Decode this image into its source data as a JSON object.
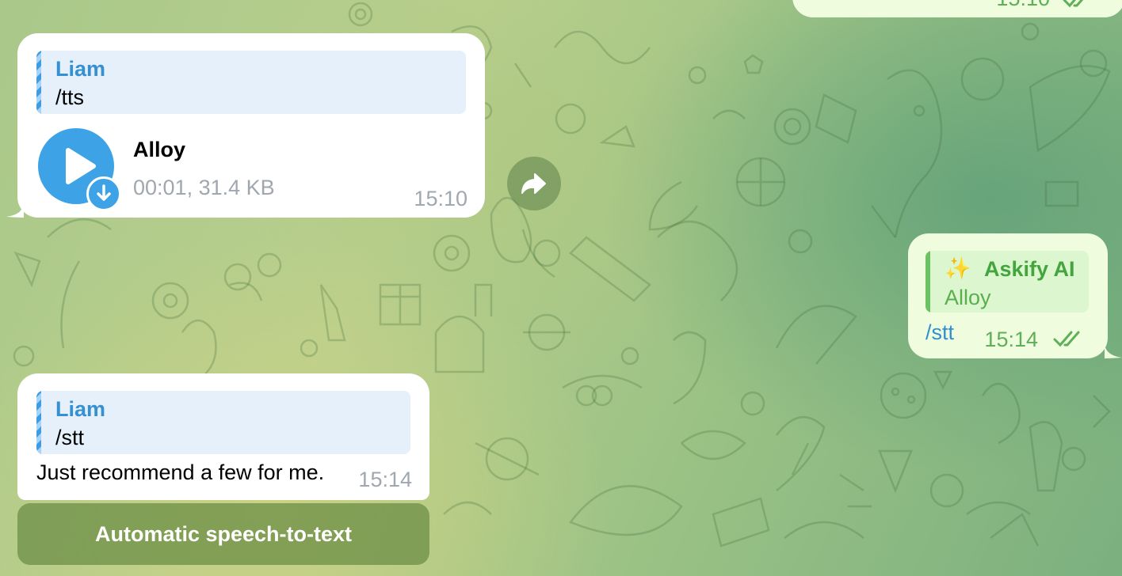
{
  "chat": {
    "messages": [
      {
        "direction": "incoming",
        "reply": {
          "name": "Liam",
          "text": "/tts"
        },
        "audio": {
          "title": "Alloy",
          "meta": "00:01, 31.4 KB"
        },
        "time": "15:10"
      },
      {
        "direction": "outgoing",
        "reply": {
          "emoji": "✨",
          "name": "Askify AI",
          "text": "Alloy"
        },
        "text": "/stt",
        "time": "15:14",
        "status": "read"
      },
      {
        "direction": "incoming",
        "reply": {
          "name": "Liam",
          "text": "/stt"
        },
        "text": "Just recommend a few for me.",
        "time": "15:14"
      }
    ],
    "top_partial_time": "15:10",
    "stt_button_label": "Automatic speech-to-text"
  },
  "icons": {
    "play": "play-icon",
    "download": "download-arrow-icon",
    "forward": "share-forward-icon",
    "read_status": "double-check-icon"
  },
  "colors": {
    "incoming_bubble": "#ffffff",
    "outgoing_bubble": "#effdde",
    "accent_blue": "#3ea2e6",
    "outgoing_green": "#44a43e",
    "time_gray": "#a0a7ae"
  }
}
